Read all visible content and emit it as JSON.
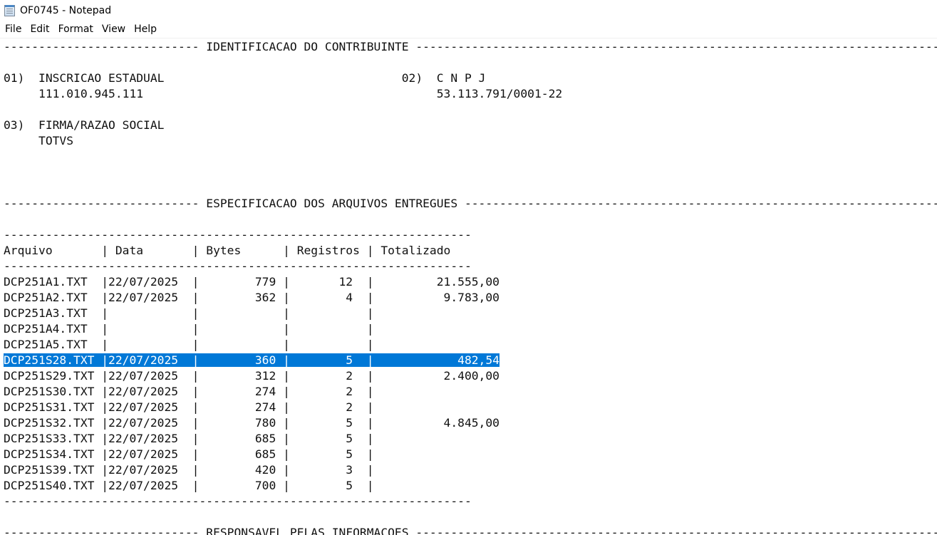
{
  "window": {
    "title": "OF0745 - Notepad",
    "icon": "notepad-icon"
  },
  "menu": [
    "File",
    "Edit",
    "Format",
    "View",
    "Help"
  ],
  "lines": [
    "---------------------------- IDENTIFICACAO DO CONTRIBUINTE --------------------------------------------------------------------------------",
    "",
    "01)  INSCRICAO ESTADUAL                                  02)  C N P J",
    "     111.010.945.111                                          53.113.791/0001-22",
    "",
    "03)  FIRMA/RAZAO SOCIAL",
    "     TOTVS",
    "",
    "",
    "",
    "---------------------------- ESPECIFICACAO DOS ARQUIVOS ENTREGUES -------------------------------------------------------------------------",
    "",
    "-------------------------------------------------------------------",
    "Arquivo       | Data       | Bytes      | Registros | Totalizado",
    "-------------------------------------------------------------------",
    "DCP251A1.TXT  |22/07/2025  |        779 |       12  |         21.555,00",
    "DCP251A2.TXT  |22/07/2025  |        362 |        4  |          9.783,00",
    "DCP251A3.TXT  |            |            |           |",
    "DCP251A4.TXT  |            |            |           |",
    "DCP251A5.TXT  |            |            |           |",
    "DCP251S28.TXT |22/07/2025  |        360 |        5  |            482,54",
    "DCP251S29.TXT |22/07/2025  |        312 |        2  |          2.400,00",
    "DCP251S30.TXT |22/07/2025  |        274 |        2  |",
    "DCP251S31.TXT |22/07/2025  |        274 |        2  |",
    "DCP251S32.TXT |22/07/2025  |        780 |        5  |          4.845,00",
    "DCP251S33.TXT |22/07/2025  |        685 |        5  |",
    "DCP251S34.TXT |22/07/2025  |        685 |        5  |",
    "DCP251S39.TXT |22/07/2025  |        420 |        3  |",
    "DCP251S40.TXT |22/07/2025  |        700 |        5  |",
    "-------------------------------------------------------------------",
    "",
    "---------------------------- RESPONSAVEL PELAS INFORMACOES --------------------------------------------------------------------------------"
  ],
  "selection": {
    "line_index": 20
  }
}
